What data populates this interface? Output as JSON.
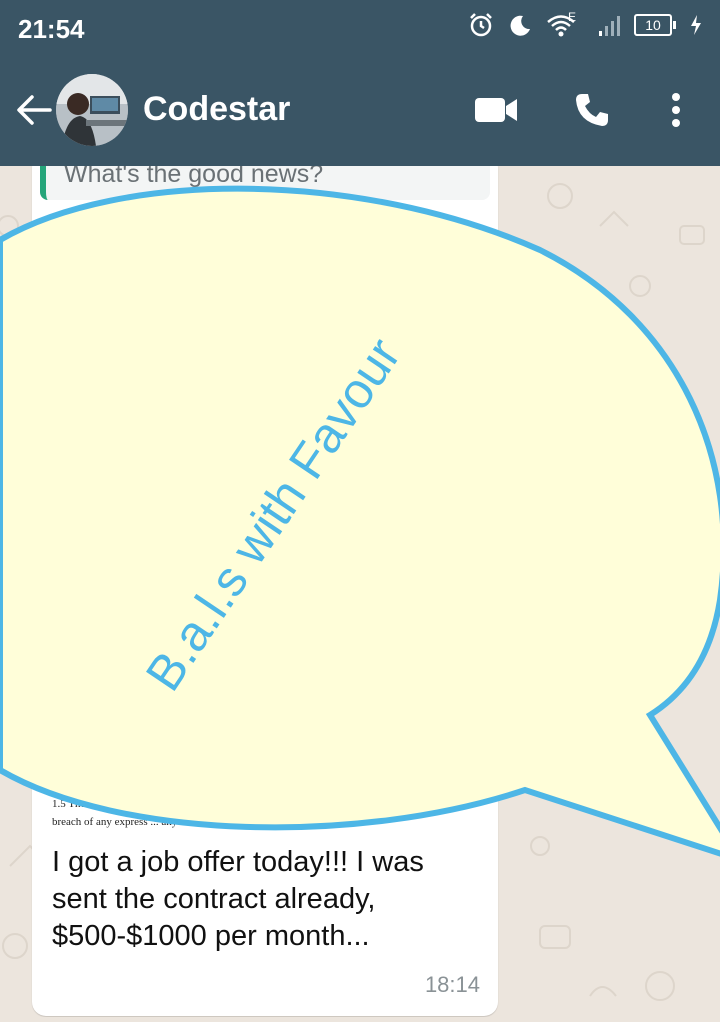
{
  "status_bar": {
    "time": "21:54",
    "network_type": "E",
    "battery_level": "10",
    "icons": [
      "alarm-icon",
      "moon-icon",
      "wifi-icon",
      "signal-icon",
      "battery-icon",
      "charging-icon"
    ]
  },
  "header": {
    "contact_name": "Codestar",
    "icons": [
      "back-arrow-icon",
      "video-call-icon",
      "phone-call-icon",
      "more-options-icon"
    ]
  },
  "message": {
    "quoted_text": "What's the good news?",
    "document_line_1": "1.5 The ... not be i",
    "document_line_2": "breach of any express ... any third-party",
    "text": "I got a job offer today!!! I was sent the contract already, $500-$1000 per month...",
    "time": "18:14"
  },
  "overlay": {
    "text": "B.a.l.s with Favour"
  },
  "colors": {
    "header_bg": "#3a5565",
    "chat_bg": "#ece5dd",
    "overlay_fill": "#fffed9",
    "overlay_stroke": "#4db6e6",
    "quote_bar": "#25a57a"
  }
}
